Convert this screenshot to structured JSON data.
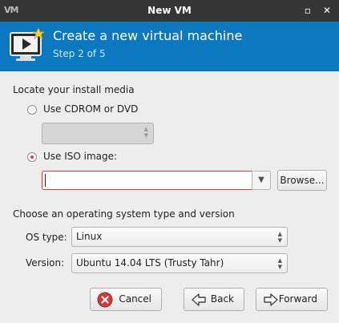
{
  "window": {
    "title": "New VM",
    "logo_text": "VM",
    "restore_glyph": "▫",
    "close_glyph": "✕"
  },
  "header": {
    "title": "Create a new virtual machine",
    "step": "Step 2 of 5",
    "icon": "monitor-play-star-icon"
  },
  "install_media": {
    "section_label": "Locate your install media",
    "cdrom": {
      "label": "Use CDROM or DVD",
      "selected": false,
      "combo_value": ""
    },
    "iso": {
      "label": "Use ISO image:",
      "selected": true,
      "path_value": "",
      "browse_label": "Browse..."
    }
  },
  "os": {
    "section_label": "Choose an operating system type and version",
    "type_label": "OS type:",
    "type_value": "Linux",
    "version_label": "Version:",
    "version_value": "Ubuntu 14.04 LTS (Trusty Tahr)"
  },
  "buttons": {
    "cancel": "Cancel",
    "back": "Back",
    "forward": "Forward"
  },
  "colors": {
    "header_bg": "#0b78bf",
    "titlebar_bg": "#353535",
    "error_border": "#d13d3d",
    "radio_dot": "#e03b3b"
  }
}
